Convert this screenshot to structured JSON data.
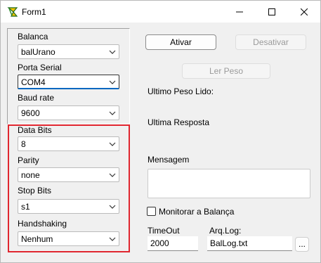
{
  "window": {
    "title": "Form1",
    "icons": {
      "app": "delphi-app-icon",
      "minimize": "minimize-icon",
      "maximize": "maximize-icon",
      "close": "close-icon"
    }
  },
  "left": {
    "balanca": {
      "label": "Balanca",
      "value": "balUrano"
    },
    "porta": {
      "label": "Porta Serial",
      "value": "COM4"
    },
    "baud": {
      "label": "Baud rate",
      "value": "9600"
    },
    "databits": {
      "label": "Data Bits",
      "value": "8"
    },
    "parity": {
      "label": "Parity",
      "value": "none"
    },
    "stopbits": {
      "label": "Stop Bits",
      "value": "s1"
    },
    "handshaking": {
      "label": "Handshaking",
      "value": "Nenhum"
    }
  },
  "right": {
    "ativar": "Ativar",
    "desativar": "Desativar",
    "lerpeso": "Ler Peso",
    "ultimo_peso": "Ultimo Peso Lido:",
    "ultima_resposta": "Ultima Resposta",
    "mensagem": "Mensagem",
    "monitorar": "Monitorar a Balança",
    "timeout_label": "TimeOut",
    "timeout_value": "2000",
    "arqlog_label": "Arq.Log:",
    "arqlog_value": "BalLog.txt",
    "browse": "..."
  },
  "colors": {
    "highlight_box": "#e0262f",
    "focus_underline": "#0067c0"
  }
}
